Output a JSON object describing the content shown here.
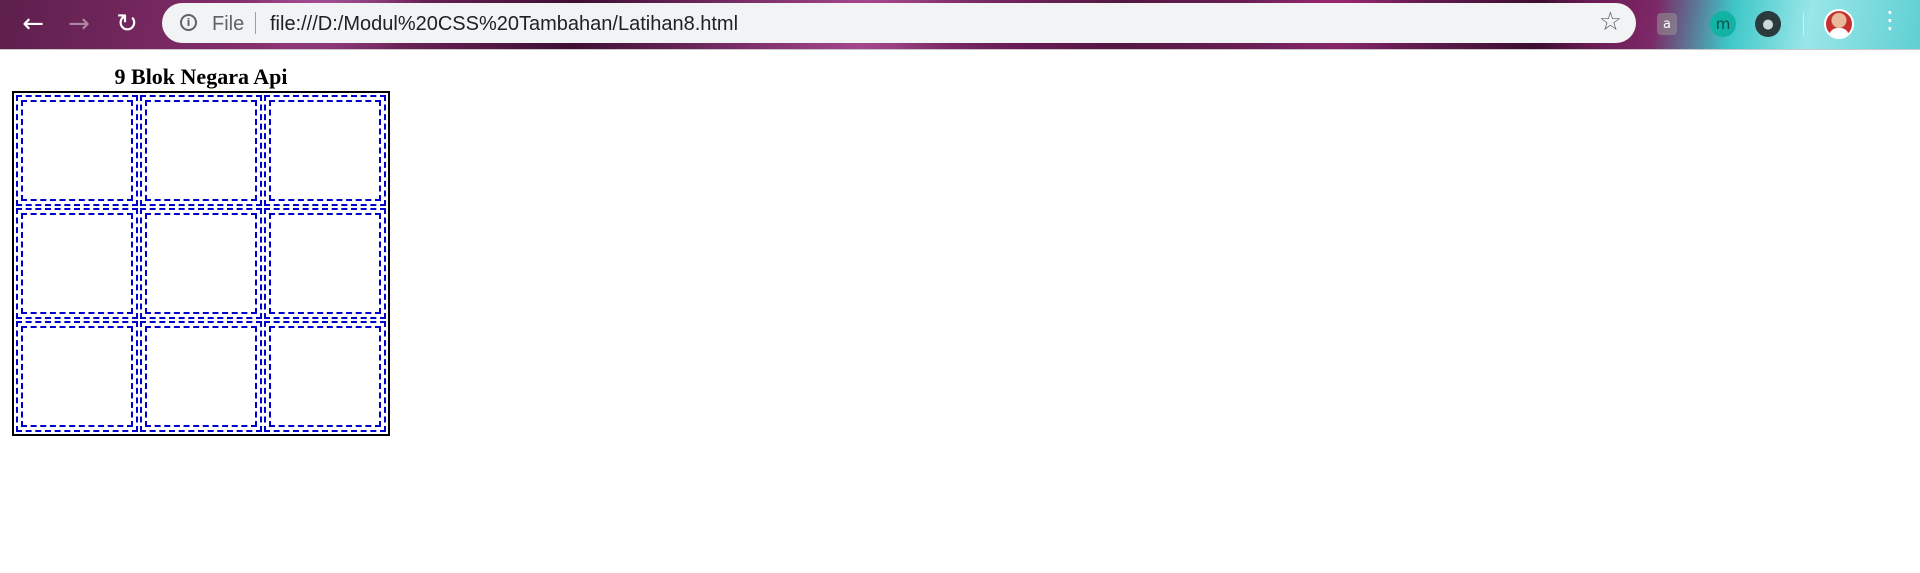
{
  "browser": {
    "address_bar": {
      "scheme_label": "File",
      "url": "file:///D:/Modul%20CSS%20Tambahan/Latihan8.html"
    },
    "extensions": {
      "bag_glyph": "a",
      "m_glyph": "m",
      "bulb_glyph": "●"
    },
    "icons": {
      "back": "back-arrow-icon",
      "forward": "forward-arrow-icon",
      "reload": "reload-icon",
      "info": "info-icon",
      "star": "star-icon",
      "menu": "kebab-menu-icon"
    }
  },
  "page": {
    "table": {
      "caption": "9 Blok Negara Api",
      "rows": [
        [
          "",
          "",
          ""
        ],
        [
          "",
          "",
          ""
        ],
        [
          "",
          "",
          ""
        ]
      ]
    }
  },
  "colors": {
    "cell_border": "#0000cc",
    "table_border": "#000000"
  }
}
